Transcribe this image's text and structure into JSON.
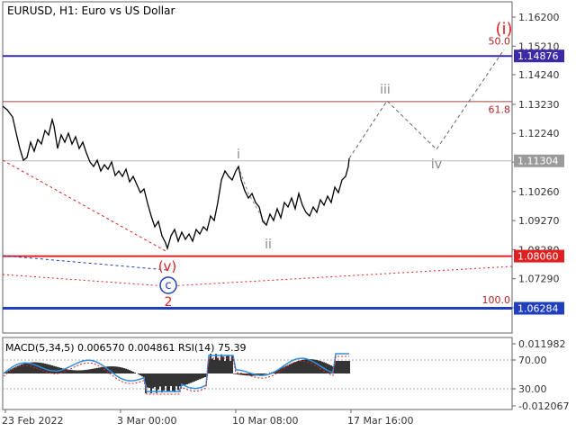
{
  "chart_data": {
    "type": "line",
    "title": "EURUSD, H1:  Euro vs US Dollar",
    "price_ticks": [
      "1.16200",
      "1.15210",
      "1.14240",
      "1.13230",
      "1.12240",
      "1.11260",
      "1.10260",
      "1.09270",
      "1.08280",
      "1.07290",
      "1.06300"
    ],
    "date_ticks": [
      "23 Feb 2022",
      "3 Mar 00:00",
      "10 Mar 08:00",
      "17 Mar 16:00"
    ],
    "price_badges": [
      {
        "label": "1.14876",
        "value": 1.14876,
        "color": "#3a2aa8"
      },
      {
        "label": "1.11304",
        "value": 1.11304,
        "color": "#9a9a9a"
      },
      {
        "label": "1.08060",
        "value": 1.0806,
        "color": "#e02020"
      },
      {
        "label": "1.06284",
        "value": 1.06284,
        "color": "#1f3fbf"
      }
    ],
    "horizontal_levels": [
      {
        "value": 1.14876,
        "color": "#3a2aa8",
        "width": 2
      },
      {
        "value": 1.13323,
        "color": "#a04545",
        "width": 1
      },
      {
        "value": 1.11304,
        "color": "#b8b8b8",
        "width": 1
      },
      {
        "value": 1.0806,
        "color": "#e02020",
        "width": 2
      },
      {
        "value": 1.06284,
        "color": "#1f3fbf",
        "width": 3
      }
    ],
    "fib_labels": [
      {
        "text": "50.0",
        "value": 1.1521
      },
      {
        "text": "61.8",
        "value": 1.1287
      },
      {
        "text": "100.0",
        "value": 1.0639
      }
    ],
    "wave_labels": [
      {
        "text": "(i)",
        "color": "#e02020"
      },
      {
        "text": "iii",
        "color": "#888888"
      },
      {
        "text": "iv",
        "color": "#888888"
      },
      {
        "text": "i",
        "color": "#888888"
      },
      {
        "text": "ii",
        "color": "#888888"
      },
      {
        "text": "(v)",
        "color": "#e02020"
      },
      {
        "text": "c",
        "color": "#1f3fbf"
      },
      {
        "text": "2",
        "color": "#e02020"
      }
    ],
    "macd_label": "MACD(5,34,5) 0.006570 0.004861 RSI(14) 75.39",
    "macd_ticks": [
      "0.011982",
      "70.00",
      "30.00",
      "-0.012067"
    ],
    "colors": {
      "price": "#000000",
      "macd_hist": "#000000",
      "rsi": "#2f8fe0",
      "signal": "#e02020",
      "projection": "#666666"
    }
  }
}
